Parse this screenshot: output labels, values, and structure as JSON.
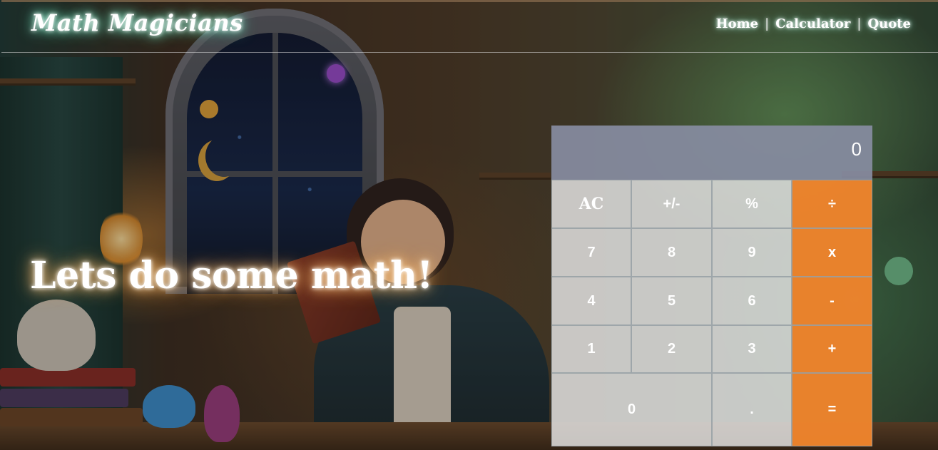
{
  "navbar": {
    "brand": "Math Magicians",
    "links": [
      {
        "label": "Home"
      },
      {
        "label": "Calculator"
      },
      {
        "label": "Quote"
      }
    ],
    "separator": "|"
  },
  "hero": {
    "heading": "Lets do some math!"
  },
  "calculator": {
    "display": "0",
    "rows": [
      [
        "AC",
        "+/-",
        "%",
        "÷"
      ],
      [
        "7",
        "8",
        "9",
        "x"
      ],
      [
        "4",
        "5",
        "6",
        "-"
      ],
      [
        "1",
        "2",
        "3",
        "+"
      ],
      [
        "0",
        ".",
        "="
      ]
    ]
  },
  "colors": {
    "operator": "#EE842C",
    "display_bg": "#878CA0",
    "key_bg": "#E8E8E8",
    "glow_brand": "#46D6A6",
    "glow_hero": "#FF9D3A"
  }
}
